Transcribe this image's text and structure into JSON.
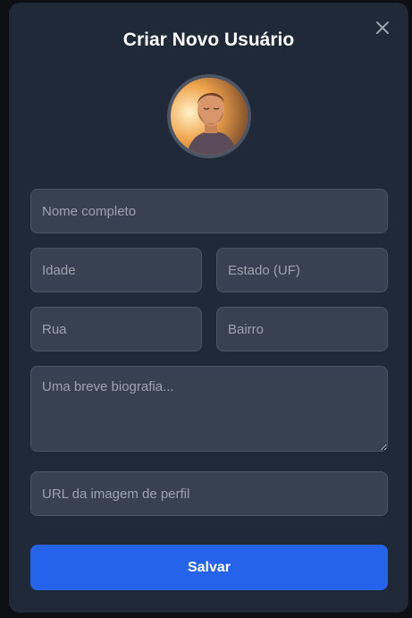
{
  "modal": {
    "title": "Criar Novo Usuário",
    "close_icon": "close-icon"
  },
  "avatar": {
    "icon": "profile-photo"
  },
  "form": {
    "name_placeholder": "Nome completo",
    "age_placeholder": "Idade",
    "state_placeholder": "Estado (UF)",
    "street_placeholder": "Rua",
    "neighborhood_placeholder": "Bairro",
    "bio_placeholder": "Uma breve biografia...",
    "image_url_placeholder": "URL da imagem de perfil",
    "save_label": "Salvar"
  },
  "colors": {
    "modal_bg": "#1f2937",
    "input_bg": "#374151",
    "accent": "#2563eb"
  }
}
